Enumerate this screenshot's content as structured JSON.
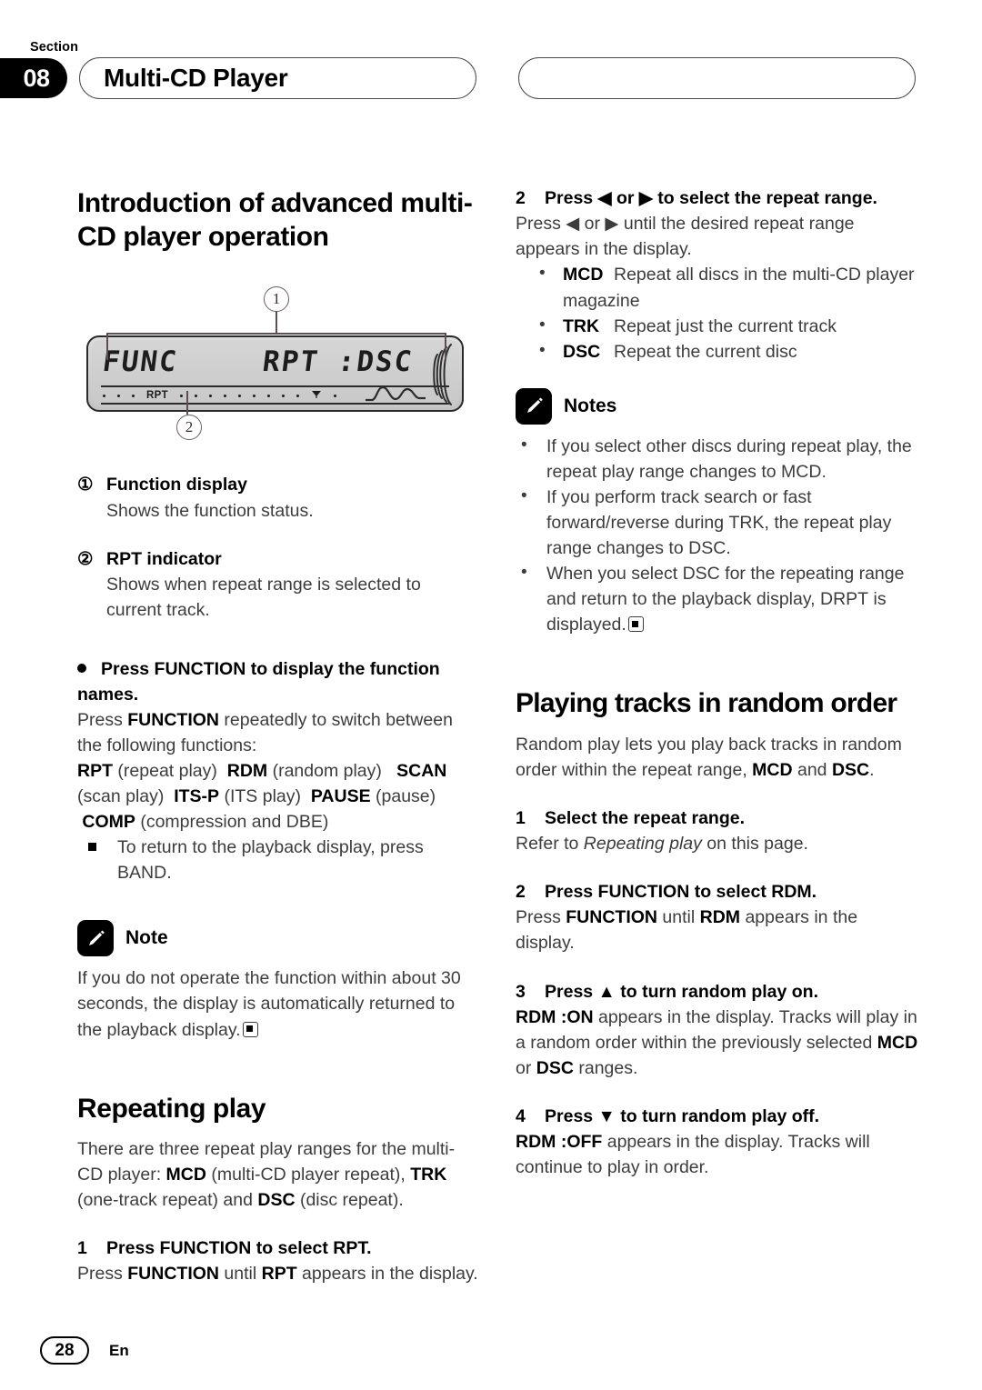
{
  "header": {
    "section_label": "Section",
    "section_number": "08",
    "title": "Multi-CD Player"
  },
  "left_column": {
    "heading": "Introduction of advanced multi-CD player operation",
    "figure": {
      "callout_1": "1",
      "callout_2": "2",
      "lcd_left_text": "FUNC",
      "lcd_right_text": "RPT :DSC",
      "lcd_indicator": "RPT"
    },
    "callouts": [
      {
        "num": "1",
        "title": "Function display",
        "body": "Shows the function status."
      },
      {
        "num": "2",
        "title": "RPT indicator",
        "body": "Shows when repeat range is selected to current track."
      }
    ],
    "function_bullet": {
      "heading": "Press FUNCTION to display the function names.",
      "intro_1": "Press ",
      "intro_bold": "FUNCTION",
      "intro_2": " repeatedly to switch between the following functions:",
      "functions": [
        {
          "code": "RPT",
          "desc": "(repeat play)"
        },
        {
          "code": "RDM",
          "desc": "(random play)"
        },
        {
          "code": "SCAN",
          "desc": "(scan play)"
        },
        {
          "code": "ITS-P",
          "desc": "(ITS play)"
        },
        {
          "code": "PAUSE",
          "desc": "(pause)"
        },
        {
          "code": "COMP",
          "desc": "(compression and DBE)"
        }
      ],
      "square_note_pre": "To return to the playback display, press ",
      "square_note_bold": "BAND",
      "square_note_post": "."
    },
    "note": {
      "title": "Note",
      "text": "If you do not operate the function within about 30 seconds, the display is automatically returned to the playback display."
    },
    "repeating": {
      "heading": "Repeating play",
      "intro_a": "There are three repeat play ranges for the multi-CD player: ",
      "intro_mcd": "MCD",
      "intro_b": " (multi-CD player repeat), ",
      "intro_trk": "TRK",
      "intro_c": " (one-track repeat) and ",
      "intro_dsc": "DSC",
      "intro_d": " (disc repeat).",
      "step1_num": "1",
      "step1_title": "Press FUNCTION to select RPT.",
      "step1_a": "Press ",
      "step1_b": "FUNCTION",
      "step1_c": " until ",
      "step1_d": "RPT",
      "step1_e": " appears in the display."
    }
  },
  "right_column": {
    "step2": {
      "num": "2",
      "title": "Press ◀ or ▶ to select the repeat range.",
      "body_a": "Press ◀ or ▶ until the desired repeat range appears in the display.",
      "ranges": [
        {
          "code": "MCD",
          "desc": "Repeat all discs in the multi-CD player magazine"
        },
        {
          "code": "TRK",
          "desc": "Repeat just the current track"
        },
        {
          "code": "DSC",
          "desc": "Repeat the current disc"
        }
      ]
    },
    "notes": {
      "title": "Notes",
      "items": [
        {
          "a": "If you select other discs during repeat play, the repeat play range changes to ",
          "bold": "MCD",
          "b": "."
        },
        {
          "a": "If you perform track search or fast forward/reverse during ",
          "bold": "TRK",
          "b": ", the repeat play range changes to ",
          "bold2": "DSC",
          "c": "."
        },
        {
          "a": "When you select ",
          "bold": "DSC",
          "b": " for the repeating range and return to the playback display, ",
          "bold2": "DRPT",
          "c": " is displayed."
        }
      ]
    },
    "random": {
      "heading": "Playing tracks in random order",
      "intro_a": "Random play lets you play back tracks in random order within the repeat range, ",
      "intro_mcd": "MCD",
      "intro_b": " and ",
      "intro_dsc": "DSC",
      "intro_c": ".",
      "steps": [
        {
          "num": "1",
          "title": "Select the repeat range.",
          "body_a": "Refer to ",
          "body_i": "Repeating play",
          "body_b": " on this page."
        },
        {
          "num": "2",
          "title": "Press FUNCTION to select RDM.",
          "body_a": "Press ",
          "body_b1": "FUNCTION",
          "body_b": " until ",
          "body_b2": "RDM",
          "body_c": " appears in the display."
        },
        {
          "num": "3",
          "title": "Press ▲ to turn random play on.",
          "body_b1": "RDM :ON",
          "body_c": " appears in the display. Tracks will play in a random order within the previously selected ",
          "body_b2": "MCD",
          "body_d": " or ",
          "body_b3": "DSC",
          "body_e": " ranges."
        },
        {
          "num": "4",
          "title": "Press ▼ to turn random play off.",
          "body_b1": "RDM :OFF",
          "body_c": " appears in the display. Tracks will continue to play in order."
        }
      ]
    }
  },
  "footer": {
    "page_number": "28",
    "language": "En"
  }
}
